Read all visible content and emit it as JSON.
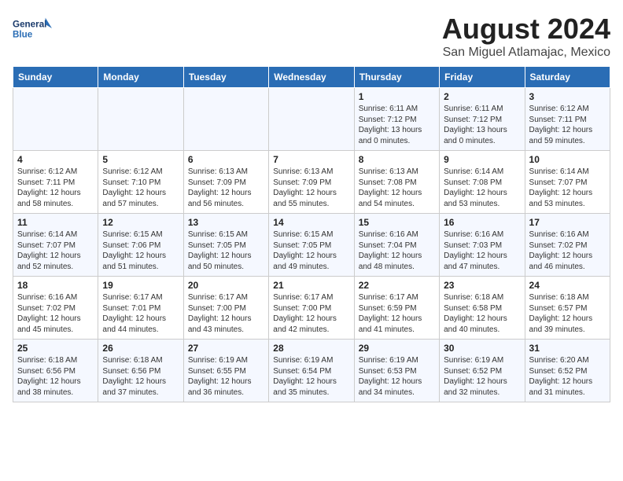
{
  "header": {
    "logo_line1": "General",
    "logo_line2": "Blue",
    "month": "August 2024",
    "location": "San Miguel Atlamajac, Mexico"
  },
  "weekdays": [
    "Sunday",
    "Monday",
    "Tuesday",
    "Wednesday",
    "Thursday",
    "Friday",
    "Saturday"
  ],
  "weeks": [
    [
      {
        "day": "",
        "info": ""
      },
      {
        "day": "",
        "info": ""
      },
      {
        "day": "",
        "info": ""
      },
      {
        "day": "",
        "info": ""
      },
      {
        "day": "1",
        "info": "Sunrise: 6:11 AM\nSunset: 7:12 PM\nDaylight: 13 hours\nand 0 minutes."
      },
      {
        "day": "2",
        "info": "Sunrise: 6:11 AM\nSunset: 7:12 PM\nDaylight: 13 hours\nand 0 minutes."
      },
      {
        "day": "3",
        "info": "Sunrise: 6:12 AM\nSunset: 7:11 PM\nDaylight: 12 hours\nand 59 minutes."
      }
    ],
    [
      {
        "day": "4",
        "info": "Sunrise: 6:12 AM\nSunset: 7:11 PM\nDaylight: 12 hours\nand 58 minutes."
      },
      {
        "day": "5",
        "info": "Sunrise: 6:12 AM\nSunset: 7:10 PM\nDaylight: 12 hours\nand 57 minutes."
      },
      {
        "day": "6",
        "info": "Sunrise: 6:13 AM\nSunset: 7:09 PM\nDaylight: 12 hours\nand 56 minutes."
      },
      {
        "day": "7",
        "info": "Sunrise: 6:13 AM\nSunset: 7:09 PM\nDaylight: 12 hours\nand 55 minutes."
      },
      {
        "day": "8",
        "info": "Sunrise: 6:13 AM\nSunset: 7:08 PM\nDaylight: 12 hours\nand 54 minutes."
      },
      {
        "day": "9",
        "info": "Sunrise: 6:14 AM\nSunset: 7:08 PM\nDaylight: 12 hours\nand 53 minutes."
      },
      {
        "day": "10",
        "info": "Sunrise: 6:14 AM\nSunset: 7:07 PM\nDaylight: 12 hours\nand 53 minutes."
      }
    ],
    [
      {
        "day": "11",
        "info": "Sunrise: 6:14 AM\nSunset: 7:07 PM\nDaylight: 12 hours\nand 52 minutes."
      },
      {
        "day": "12",
        "info": "Sunrise: 6:15 AM\nSunset: 7:06 PM\nDaylight: 12 hours\nand 51 minutes."
      },
      {
        "day": "13",
        "info": "Sunrise: 6:15 AM\nSunset: 7:05 PM\nDaylight: 12 hours\nand 50 minutes."
      },
      {
        "day": "14",
        "info": "Sunrise: 6:15 AM\nSunset: 7:05 PM\nDaylight: 12 hours\nand 49 minutes."
      },
      {
        "day": "15",
        "info": "Sunrise: 6:16 AM\nSunset: 7:04 PM\nDaylight: 12 hours\nand 48 minutes."
      },
      {
        "day": "16",
        "info": "Sunrise: 6:16 AM\nSunset: 7:03 PM\nDaylight: 12 hours\nand 47 minutes."
      },
      {
        "day": "17",
        "info": "Sunrise: 6:16 AM\nSunset: 7:02 PM\nDaylight: 12 hours\nand 46 minutes."
      }
    ],
    [
      {
        "day": "18",
        "info": "Sunrise: 6:16 AM\nSunset: 7:02 PM\nDaylight: 12 hours\nand 45 minutes."
      },
      {
        "day": "19",
        "info": "Sunrise: 6:17 AM\nSunset: 7:01 PM\nDaylight: 12 hours\nand 44 minutes."
      },
      {
        "day": "20",
        "info": "Sunrise: 6:17 AM\nSunset: 7:00 PM\nDaylight: 12 hours\nand 43 minutes."
      },
      {
        "day": "21",
        "info": "Sunrise: 6:17 AM\nSunset: 7:00 PM\nDaylight: 12 hours\nand 42 minutes."
      },
      {
        "day": "22",
        "info": "Sunrise: 6:17 AM\nSunset: 6:59 PM\nDaylight: 12 hours\nand 41 minutes."
      },
      {
        "day": "23",
        "info": "Sunrise: 6:18 AM\nSunset: 6:58 PM\nDaylight: 12 hours\nand 40 minutes."
      },
      {
        "day": "24",
        "info": "Sunrise: 6:18 AM\nSunset: 6:57 PM\nDaylight: 12 hours\nand 39 minutes."
      }
    ],
    [
      {
        "day": "25",
        "info": "Sunrise: 6:18 AM\nSunset: 6:56 PM\nDaylight: 12 hours\nand 38 minutes."
      },
      {
        "day": "26",
        "info": "Sunrise: 6:18 AM\nSunset: 6:56 PM\nDaylight: 12 hours\nand 37 minutes."
      },
      {
        "day": "27",
        "info": "Sunrise: 6:19 AM\nSunset: 6:55 PM\nDaylight: 12 hours\nand 36 minutes."
      },
      {
        "day": "28",
        "info": "Sunrise: 6:19 AM\nSunset: 6:54 PM\nDaylight: 12 hours\nand 35 minutes."
      },
      {
        "day": "29",
        "info": "Sunrise: 6:19 AM\nSunset: 6:53 PM\nDaylight: 12 hours\nand 34 minutes."
      },
      {
        "day": "30",
        "info": "Sunrise: 6:19 AM\nSunset: 6:52 PM\nDaylight: 12 hours\nand 32 minutes."
      },
      {
        "day": "31",
        "info": "Sunrise: 6:20 AM\nSunset: 6:52 PM\nDaylight: 12 hours\nand 31 minutes."
      }
    ]
  ]
}
